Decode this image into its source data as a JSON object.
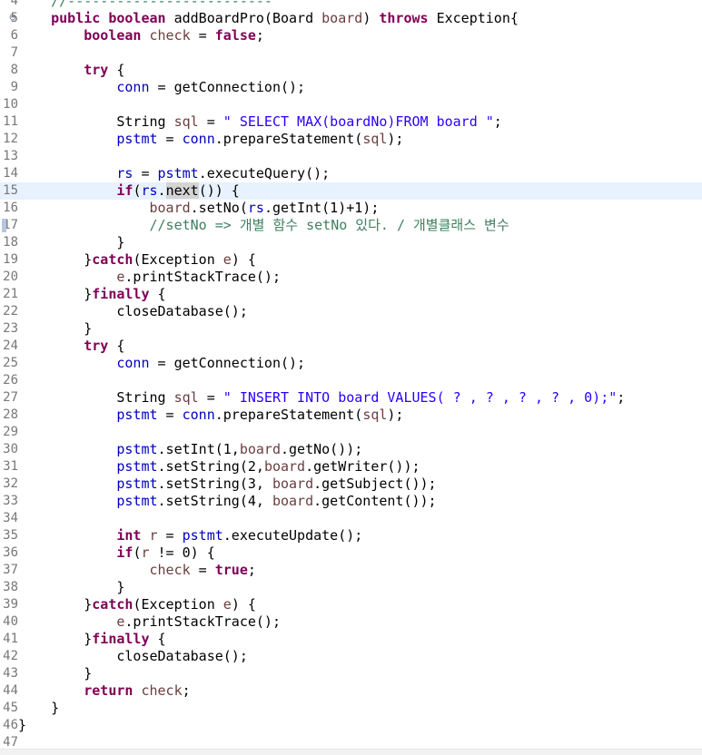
{
  "editor": {
    "fold_glyph": "⊖",
    "lines": [
      {
        "num": "4",
        "tokens": [
          {
            "t": "    "
          },
          {
            "t": "//-------------------------",
            "c": "cmt"
          }
        ]
      },
      {
        "num": "5",
        "fold": true,
        "tokens": [
          {
            "t": "    "
          },
          {
            "t": "public",
            "c": "kw"
          },
          {
            "t": " "
          },
          {
            "t": "boolean",
            "c": "kw"
          },
          {
            "t": " addBoardPro(Board "
          },
          {
            "t": "board",
            "c": "lvar"
          },
          {
            "t": ") "
          },
          {
            "t": "throws",
            "c": "kw"
          },
          {
            "t": " Exception{"
          }
        ]
      },
      {
        "num": "6",
        "tokens": [
          {
            "t": "        "
          },
          {
            "t": "boolean",
            "c": "kw"
          },
          {
            "t": " "
          },
          {
            "t": "check",
            "c": "lvar"
          },
          {
            "t": " = "
          },
          {
            "t": "false",
            "c": "kw"
          },
          {
            "t": ";"
          }
        ]
      },
      {
        "num": "7",
        "tokens": []
      },
      {
        "num": "8",
        "tokens": [
          {
            "t": "        "
          },
          {
            "t": "try",
            "c": "kw"
          },
          {
            "t": " {"
          }
        ]
      },
      {
        "num": "9",
        "tokens": [
          {
            "t": "            "
          },
          {
            "t": "conn",
            "c": "fld"
          },
          {
            "t": " = getConnection();"
          }
        ]
      },
      {
        "num": "10",
        "tokens": []
      },
      {
        "num": "11",
        "tokens": [
          {
            "t": "            String "
          },
          {
            "t": "sql",
            "c": "lvar"
          },
          {
            "t": " = "
          },
          {
            "t": "\" SELECT MAX(boardNo)FROM board \"",
            "c": "str"
          },
          {
            "t": ";"
          }
        ]
      },
      {
        "num": "12",
        "tokens": [
          {
            "t": "            "
          },
          {
            "t": "pstmt",
            "c": "fld"
          },
          {
            "t": " = "
          },
          {
            "t": "conn",
            "c": "fld"
          },
          {
            "t": ".prepareStatement("
          },
          {
            "t": "sql",
            "c": "lvar"
          },
          {
            "t": ");"
          }
        ]
      },
      {
        "num": "13",
        "tokens": []
      },
      {
        "num": "14",
        "tokens": [
          {
            "t": "            "
          },
          {
            "t": "rs",
            "c": "fld"
          },
          {
            "t": " = "
          },
          {
            "t": "pstmt",
            "c": "fld"
          },
          {
            "t": ".executeQuery();"
          }
        ]
      },
      {
        "num": "15",
        "current": true,
        "tokens": [
          {
            "t": "            "
          },
          {
            "t": "if",
            "c": "kw"
          },
          {
            "t": "("
          },
          {
            "t": "rs",
            "c": "fld"
          },
          {
            "t": "."
          },
          {
            "t": "next",
            "c": "hl"
          },
          {
            "t": "()) {"
          }
        ]
      },
      {
        "num": "16",
        "tokens": [
          {
            "t": "                "
          },
          {
            "t": "board",
            "c": "lvar"
          },
          {
            "t": ".setNo("
          },
          {
            "t": "rs",
            "c": "fld"
          },
          {
            "t": ".getInt(1)+1);"
          }
        ]
      },
      {
        "num": "17",
        "marker": true,
        "tokens": [
          {
            "t": "                "
          },
          {
            "t": "//setNo => 개별 함수 setNo 있다. / 개별클래스 변수",
            "c": "cmt"
          }
        ]
      },
      {
        "num": "18",
        "tokens": [
          {
            "t": "            }"
          }
        ]
      },
      {
        "num": "19",
        "tokens": [
          {
            "t": "        }"
          },
          {
            "t": "catch",
            "c": "kw"
          },
          {
            "t": "(Exception "
          },
          {
            "t": "e",
            "c": "lvar"
          },
          {
            "t": ") {"
          }
        ]
      },
      {
        "num": "20",
        "tokens": [
          {
            "t": "            "
          },
          {
            "t": "e",
            "c": "lvar"
          },
          {
            "t": ".printStackTrace();"
          }
        ]
      },
      {
        "num": "21",
        "tokens": [
          {
            "t": "        }"
          },
          {
            "t": "finally",
            "c": "kw"
          },
          {
            "t": " {"
          }
        ]
      },
      {
        "num": "22",
        "tokens": [
          {
            "t": "            closeDatabase();"
          }
        ]
      },
      {
        "num": "23",
        "tokens": [
          {
            "t": "        }"
          }
        ]
      },
      {
        "num": "24",
        "tokens": [
          {
            "t": "        "
          },
          {
            "t": "try",
            "c": "kw"
          },
          {
            "t": " {"
          }
        ]
      },
      {
        "num": "25",
        "tokens": [
          {
            "t": "            "
          },
          {
            "t": "conn",
            "c": "fld"
          },
          {
            "t": " = getConnection();"
          }
        ]
      },
      {
        "num": "26",
        "tokens": []
      },
      {
        "num": "27",
        "tokens": [
          {
            "t": "            String "
          },
          {
            "t": "sql",
            "c": "lvar"
          },
          {
            "t": " = "
          },
          {
            "t": "\" INSERT INTO board VALUES( ? , ? , ? , ? , 0);\"",
            "c": "str"
          },
          {
            "t": ";"
          }
        ]
      },
      {
        "num": "28",
        "tokens": [
          {
            "t": "            "
          },
          {
            "t": "pstmt",
            "c": "fld"
          },
          {
            "t": " = "
          },
          {
            "t": "conn",
            "c": "fld"
          },
          {
            "t": ".prepareStatement("
          },
          {
            "t": "sql",
            "c": "lvar"
          },
          {
            "t": ");"
          }
        ]
      },
      {
        "num": "29",
        "tokens": []
      },
      {
        "num": "30",
        "tokens": [
          {
            "t": "            "
          },
          {
            "t": "pstmt",
            "c": "fld"
          },
          {
            "t": ".setInt(1,"
          },
          {
            "t": "board",
            "c": "lvar"
          },
          {
            "t": ".getNo());"
          }
        ]
      },
      {
        "num": "31",
        "tokens": [
          {
            "t": "            "
          },
          {
            "t": "pstmt",
            "c": "fld"
          },
          {
            "t": ".setString(2,"
          },
          {
            "t": "board",
            "c": "lvar"
          },
          {
            "t": ".getWriter());"
          }
        ]
      },
      {
        "num": "32",
        "tokens": [
          {
            "t": "            "
          },
          {
            "t": "pstmt",
            "c": "fld"
          },
          {
            "t": ".setString(3, "
          },
          {
            "t": "board",
            "c": "lvar"
          },
          {
            "t": ".getSubject());"
          }
        ]
      },
      {
        "num": "33",
        "tokens": [
          {
            "t": "            "
          },
          {
            "t": "pstmt",
            "c": "fld"
          },
          {
            "t": ".setString(4, "
          },
          {
            "t": "board",
            "c": "lvar"
          },
          {
            "t": ".getContent());"
          }
        ]
      },
      {
        "num": "34",
        "tokens": []
      },
      {
        "num": "35",
        "tokens": [
          {
            "t": "            "
          },
          {
            "t": "int",
            "c": "kw"
          },
          {
            "t": " "
          },
          {
            "t": "r",
            "c": "lvar"
          },
          {
            "t": " = "
          },
          {
            "t": "pstmt",
            "c": "fld"
          },
          {
            "t": ".executeUpdate();"
          }
        ]
      },
      {
        "num": "36",
        "tokens": [
          {
            "t": "            "
          },
          {
            "t": "if",
            "c": "kw"
          },
          {
            "t": "("
          },
          {
            "t": "r",
            "c": "lvar"
          },
          {
            "t": " != 0) {"
          }
        ]
      },
      {
        "num": "37",
        "tokens": [
          {
            "t": "                "
          },
          {
            "t": "check",
            "c": "lvar"
          },
          {
            "t": " = "
          },
          {
            "t": "true",
            "c": "kw"
          },
          {
            "t": ";"
          }
        ]
      },
      {
        "num": "38",
        "tokens": [
          {
            "t": "            }"
          }
        ]
      },
      {
        "num": "39",
        "tokens": [
          {
            "t": "        }"
          },
          {
            "t": "catch",
            "c": "kw"
          },
          {
            "t": "(Exception "
          },
          {
            "t": "e",
            "c": "lvar"
          },
          {
            "t": ") {"
          }
        ]
      },
      {
        "num": "40",
        "tokens": [
          {
            "t": "            "
          },
          {
            "t": "e",
            "c": "lvar"
          },
          {
            "t": ".printStackTrace();"
          }
        ]
      },
      {
        "num": "41",
        "tokens": [
          {
            "t": "        }"
          },
          {
            "t": "finally",
            "c": "kw"
          },
          {
            "t": " {"
          }
        ]
      },
      {
        "num": "42",
        "tokens": [
          {
            "t": "            closeDatabase();"
          }
        ]
      },
      {
        "num": "43",
        "tokens": [
          {
            "t": "        }"
          }
        ]
      },
      {
        "num": "44",
        "tokens": [
          {
            "t": "        "
          },
          {
            "t": "return",
            "c": "kw"
          },
          {
            "t": " "
          },
          {
            "t": "check",
            "c": "lvar"
          },
          {
            "t": ";"
          }
        ]
      },
      {
        "num": "45",
        "tokens": [
          {
            "t": "    }"
          }
        ]
      },
      {
        "num": "46",
        "tokens": [
          {
            "t": "}"
          }
        ]
      },
      {
        "num": "47",
        "tokens": []
      }
    ]
  }
}
